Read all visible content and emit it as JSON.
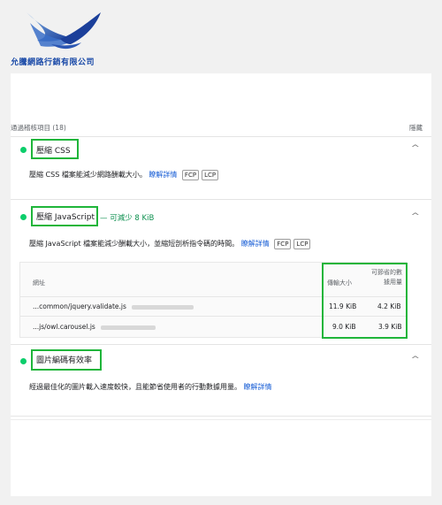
{
  "company": {
    "name": "允騰網路行銷有限公司"
  },
  "group": {
    "label": "通過稽核項目 (18)",
    "hide_label": "隱藏"
  },
  "audits": [
    {
      "title": "壓縮 CSS",
      "saving": "",
      "description": "壓縮 CSS 檔案能減少網路酬載大小。",
      "link": "瞭解詳情",
      "chips": [
        "FCP",
        "LCP"
      ]
    },
    {
      "title": "壓縮 JavaScript",
      "saving": "— 可減少 8 KiB",
      "description": "壓縮 JavaScript 檔案能減少酬載大小，並縮短剖析指令碼的時間。",
      "link": "瞭解詳情",
      "chips": [
        "FCP",
        "LCP"
      ]
    },
    {
      "title": "圖片編碼有效率",
      "saving": "",
      "description": "經過最佳化的圖片載入速度較快，且能節省使用者的行動數據用量。",
      "link": "瞭解詳情",
      "chips": []
    }
  ],
  "table": {
    "col_url": "網址",
    "col_transfer": "傳輸大小",
    "col_savings": "可節省的數據用量",
    "rows": [
      {
        "url": "...common/jquery.validate.js",
        "transfer": "11.9 KiB",
        "savings": "4.2 KiB"
      },
      {
        "url": "...js/owl.carousel.js",
        "transfer": "9.0 KiB",
        "savings": "3.9 KiB"
      }
    ]
  },
  "icons": {
    "logo": "bird-logo-icon",
    "collapse": "chevron-up-icon",
    "status": "pass-dot-icon"
  },
  "colors": {
    "pass_green": "#0cce6b",
    "highlight_green": "#1fb53a",
    "link_blue": "#1a5fd6",
    "brand_blue": "#1a4aa8"
  }
}
